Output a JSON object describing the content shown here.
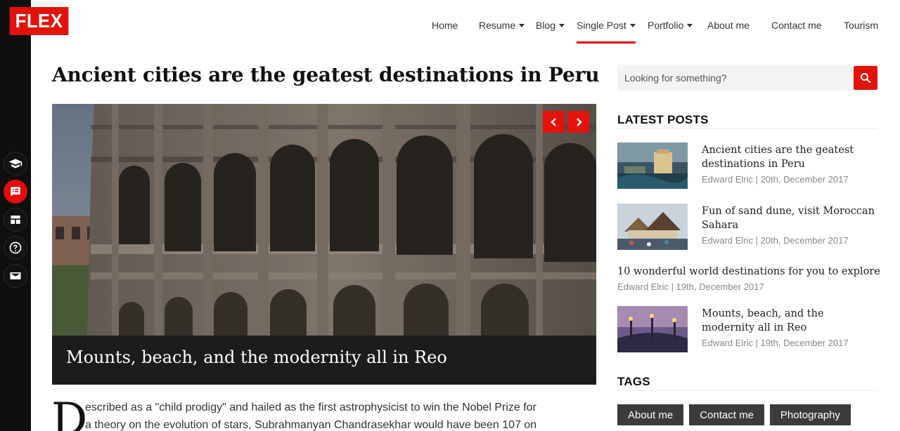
{
  "brand": {
    "logo_text": "FLEX",
    "accent": "#e3120b"
  },
  "nav": {
    "items": [
      {
        "label": "Home",
        "has_caret": false,
        "active": false
      },
      {
        "label": "Resume",
        "has_caret": true,
        "active": false
      },
      {
        "label": "Blog",
        "has_caret": true,
        "active": false
      },
      {
        "label": "Single Post",
        "has_caret": true,
        "active": true
      },
      {
        "label": "Portfolio",
        "has_caret": true,
        "active": false
      },
      {
        "label": "About me",
        "has_caret": false,
        "active": false
      },
      {
        "label": "Contact me",
        "has_caret": false,
        "active": false
      },
      {
        "label": "Tourism",
        "has_caret": false,
        "active": false
      }
    ]
  },
  "rail": {
    "icons": [
      "graduation-cap-icon",
      "list-icon",
      "dashboard-icon",
      "question-icon",
      "envelope-icon"
    ],
    "active_icon": "list-icon"
  },
  "post": {
    "title": "Ancient cities are the geatest destinations in Peru",
    "slide_caption": "Mounts, beach, and the modernity all in Reo",
    "dropcap": "D",
    "body_lines": [
      "escribed as a \"child prodigy\" and hailed as the first astrophysicist to win the Nobel Prize for",
      "a theory on the evolution of stars, Subrahmanyan Chandrasekhar would have been 107 on"
    ]
  },
  "search": {
    "placeholder": "Looking for something?",
    "value": ""
  },
  "latest_posts": {
    "heading": "LATEST POSTS",
    "items": [
      {
        "title": "Ancient cities are the geatest destinations in Peru",
        "meta": "Edward Elric | 20th, December 2017",
        "has_thumb": true,
        "thumb": "resort-thumbnail"
      },
      {
        "title": "Fun of sand dune, visit Moroccan Sahara",
        "meta": "Edward Elric | 20th, December 2017",
        "has_thumb": true,
        "thumb": "temple-thumbnail"
      },
      {
        "title": "10 wonderful world destinations for you to explore",
        "meta": "Edward Elric | 19th, December 2017",
        "has_thumb": false
      },
      {
        "title": "Mounts, beach, and the modernity all in Reo",
        "meta": "Edward Elric | 19th, December 2017",
        "has_thumb": true,
        "thumb": "bridge-thumbnail"
      }
    ]
  },
  "tags": {
    "heading": "TAGS",
    "items": [
      "About me",
      "Contact me",
      "Photography"
    ]
  }
}
